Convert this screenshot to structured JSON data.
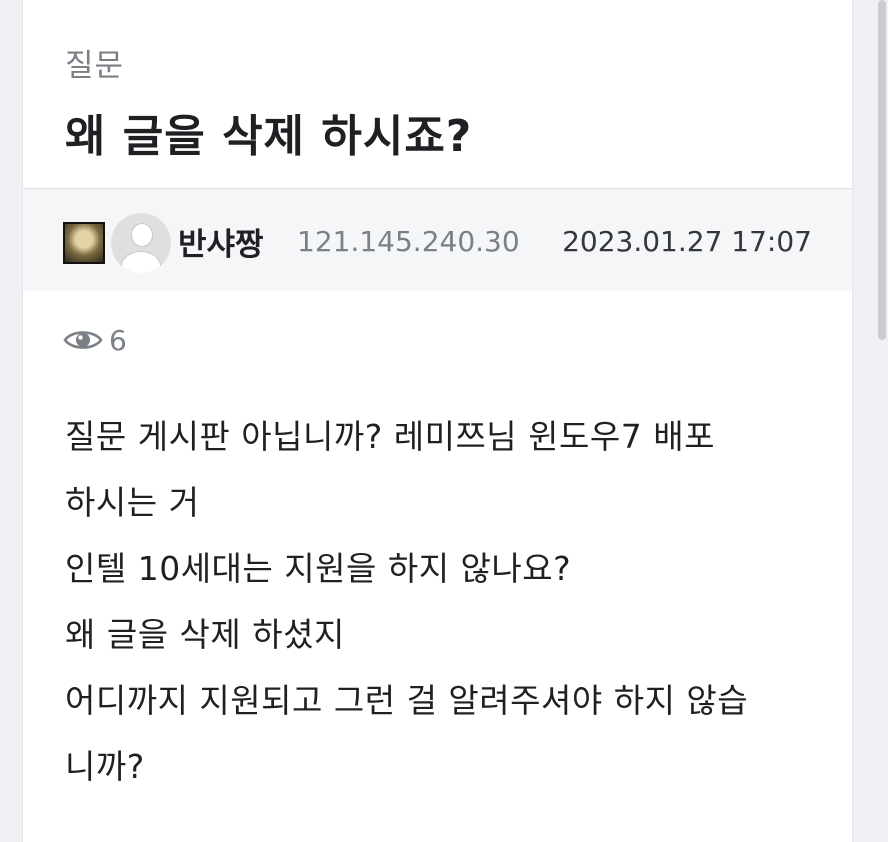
{
  "post": {
    "category": "질문",
    "title": "왜 글을 삭제 하시죠?",
    "author": {
      "name": "반샤짱",
      "ip": "121.145.240.30"
    },
    "datetime": "2023.01.27 17:07",
    "view_count": "6",
    "body_lines": [
      "질문 게시판 아닙니까? 레미쯔님 윈도우7 배포",
      "하시는 거",
      "인텔 10세대는 지원을 하지 않나요?",
      "왜 글을 삭제 하셨지",
      "어디까지 지원되고 그런 걸 알려주셔야 하지 않습",
      "니까?"
    ]
  },
  "icons": {
    "level": "level-badge-icon",
    "avatar": "default-avatar-icon",
    "views": "eye-icon"
  },
  "colors": {
    "background": "#eef0f3",
    "card": "#ffffff",
    "author_bar": "#f5f6f8",
    "text_primary": "#1e2023",
    "text_secondary": "#7b7f86"
  }
}
